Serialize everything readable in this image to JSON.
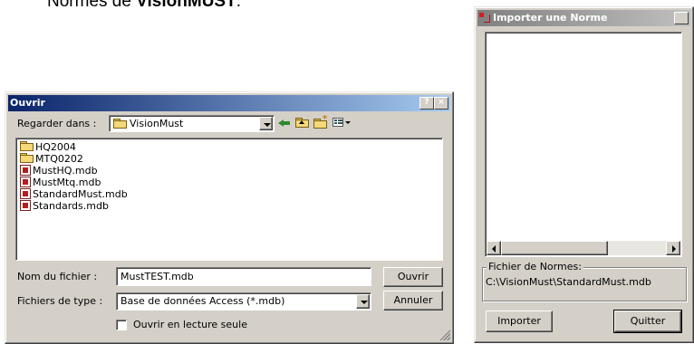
{
  "doc": {
    "heading_prefix": "Normes de ",
    "heading_bold": "VisionMUST",
    "heading_suffix": "."
  },
  "open_dialog": {
    "title": "Ouvrir",
    "help_btn": "?",
    "close_btn": "×",
    "look_in_label": "Regarder dans :",
    "look_in_value": "VisionMust",
    "files": [
      {
        "name": "HQ2004",
        "type": "folder"
      },
      {
        "name": "MTQ0202",
        "type": "folder"
      },
      {
        "name": "MustHQ.mdb",
        "type": "mdb"
      },
      {
        "name": "MustMtq.mdb",
        "type": "mdb"
      },
      {
        "name": "StandardMust.mdb",
        "type": "mdb"
      },
      {
        "name": "Standards.mdb",
        "type": "mdb"
      }
    ],
    "filename_label": "Nom du fichier :",
    "filename_value": "MustTEST.mdb",
    "filetype_label": "Fichiers de type :",
    "filetype_value": "Base de données Access (*.mdb)",
    "open_btn": "Ouvrir",
    "cancel_btn": "Annuler",
    "readonly_label": "Ouvrir en lecture seule"
  },
  "import_dialog": {
    "title": "Importer une Norme",
    "close_btn": "×",
    "group_label": "Fichier de Normes:",
    "path_value": "C:\\VisionMust\\StandardMust.mdb",
    "import_btn": "Importer",
    "quit_btn": "Quitter"
  },
  "colors": {
    "title_active": "#0a246a",
    "title_gradient_end": "#a6caf0",
    "dialog_face": "#d4d0c8"
  }
}
